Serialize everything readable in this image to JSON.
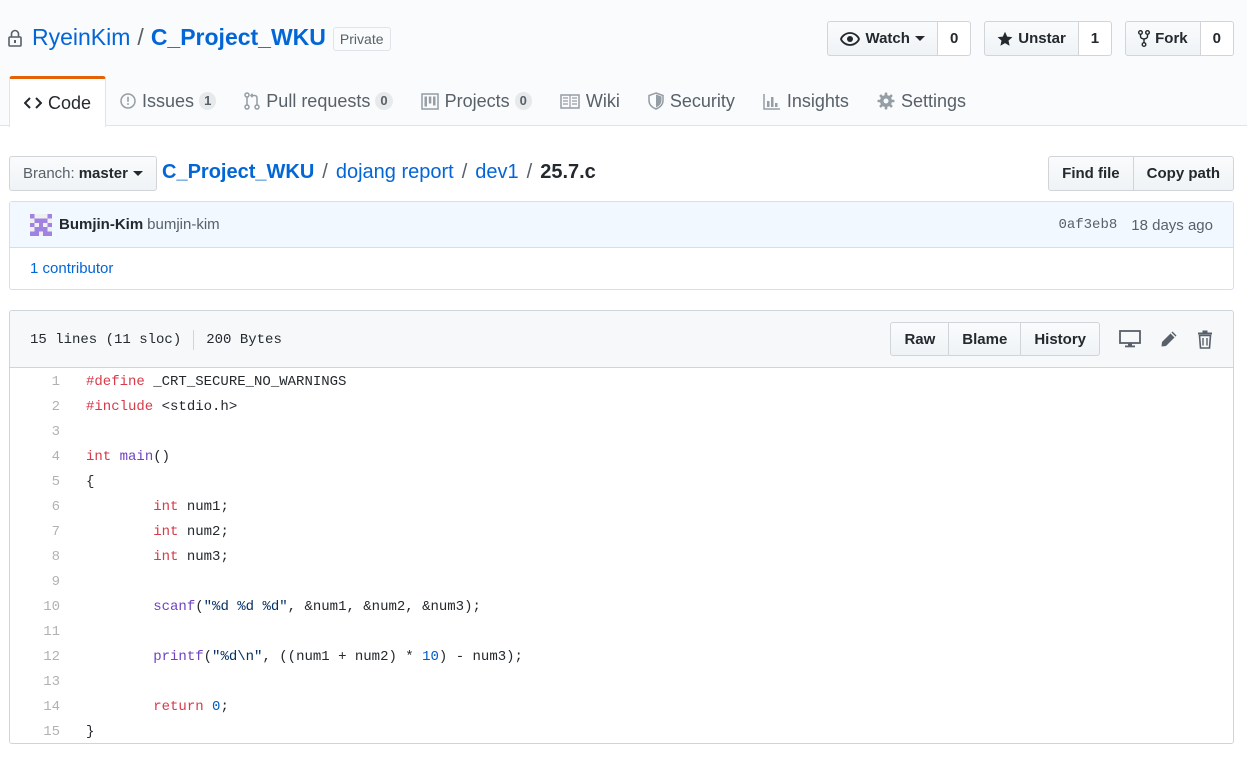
{
  "repo": {
    "owner": "RyeinKim",
    "separator": "/",
    "name": "C_Project_WKU",
    "visibility": "Private"
  },
  "actions": {
    "watch": {
      "label": "Watch",
      "count": "0"
    },
    "unstar": {
      "label": "Unstar",
      "count": "1"
    },
    "fork": {
      "label": "Fork",
      "count": "0"
    }
  },
  "nav": {
    "code": "Code",
    "issues": {
      "label": "Issues",
      "count": "1"
    },
    "pulls": {
      "label": "Pull requests",
      "count": "0"
    },
    "projects": {
      "label": "Projects",
      "count": "0"
    },
    "wiki": "Wiki",
    "security": "Security",
    "insights": "Insights",
    "settings": "Settings"
  },
  "filenav": {
    "branch_prefix": "Branch:",
    "branch": "master",
    "path_root": "C_Project_WKU",
    "path_1": "dojang report",
    "path_2": "dev1",
    "file": "25.7.c",
    "sep": "/",
    "find_file": "Find file",
    "copy_path": "Copy path"
  },
  "commit": {
    "author_name": "Bumjin-Kim",
    "author_login": "bumjin-kim",
    "sha": "0af3eb8",
    "time": "18 days ago",
    "contributors": "1 contributor"
  },
  "file": {
    "lines_info": "15 lines (11 sloc)",
    "size": "200 Bytes",
    "raw": "Raw",
    "blame": "Blame",
    "history": "History"
  },
  "code_lines": [
    "#define _CRT_SECURE_NO_WARNINGS",
    "#include <stdio.h>",
    "",
    "int main()",
    "{",
    "        int num1;",
    "        int num2;",
    "        int num3;",
    "",
    "        scanf(\"%d %d %d\", &num1, &num2, &num3);",
    "",
    "        printf(\"%d\\n\", ((num1 + num2) * 10) - num3);",
    "",
    "        return 0;",
    "}"
  ],
  "colors": {
    "link": "#0366d6",
    "tab_accent": "#e36209",
    "keyword": "#d73a49",
    "function": "#6f42c1",
    "string": "#032f62",
    "number": "#005cc5"
  }
}
